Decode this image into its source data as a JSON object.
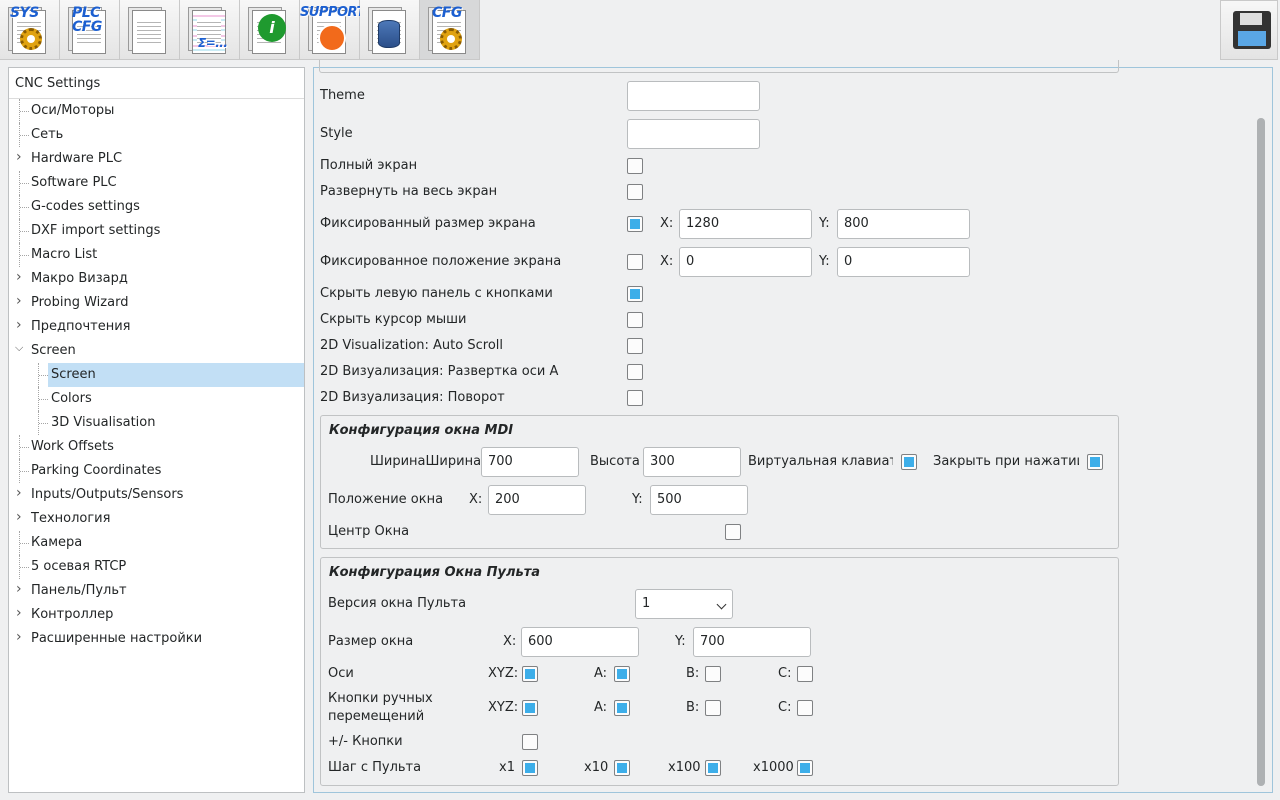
{
  "toolbar": {
    "buttons": [
      {
        "name": "sys",
        "label": "SYS"
      },
      {
        "name": "plc-cfg",
        "label": "PLC CFG"
      },
      {
        "name": "list",
        "label": ""
      },
      {
        "name": "formula",
        "label": "Σ=..."
      },
      {
        "name": "info",
        "label": "i"
      },
      {
        "name": "support",
        "label": "SUPPORT"
      },
      {
        "name": "database",
        "label": ""
      },
      {
        "name": "cfg",
        "label": "CFG"
      }
    ],
    "save_icon": "floppy-disk-icon"
  },
  "tree": {
    "header": "CNC Settings",
    "items": [
      {
        "label": "Оси/Моторы",
        "expandable": false
      },
      {
        "label": "Сеть",
        "expandable": false
      },
      {
        "label": "Hardware PLC",
        "expandable": true
      },
      {
        "label": "Software PLC",
        "expandable": false
      },
      {
        "label": "G-codes settings",
        "expandable": false
      },
      {
        "label": "DXF import settings",
        "expandable": false
      },
      {
        "label": "Macro List",
        "expandable": false
      },
      {
        "label": "Макро Визард",
        "expandable": true
      },
      {
        "label": "Probing Wizard",
        "expandable": true
      },
      {
        "label": "Предпочтения",
        "expandable": true
      },
      {
        "label": "Screen",
        "expandable": true,
        "expanded": true
      },
      {
        "label": "Screen",
        "child": true,
        "selected": true
      },
      {
        "label": "Colors",
        "child": true
      },
      {
        "label": "3D Visualisation",
        "child": true
      },
      {
        "label": "Work Offsets",
        "expandable": false
      },
      {
        "label": "Parking Coordinates",
        "expandable": false
      },
      {
        "label": "Inputs/Outputs/Sensors",
        "expandable": true
      },
      {
        "label": "Технология",
        "expandable": true
      },
      {
        "label": "Камера",
        "expandable": false
      },
      {
        "label": "5 осевая RTCP",
        "expandable": false
      },
      {
        "label": "Панель/Пульт",
        "expandable": true
      },
      {
        "label": "Контроллер",
        "expandable": true
      },
      {
        "label": "Расширенные настройки",
        "expandable": true
      }
    ]
  },
  "screen": {
    "theme_label": "Theme",
    "theme_value": "",
    "style_label": "Style",
    "style_value": "",
    "fullscreen_label": "Полный экран",
    "fullscreen": false,
    "maximize_label": "Развернуть на весь экран",
    "maximize": false,
    "fixed_size_label": "Фиксированный размер экрана",
    "fixed_size": true,
    "fixed_size_x_label": "X:",
    "fixed_size_x": "1280",
    "fixed_size_y_label": "Y:",
    "fixed_size_y": "800",
    "fixed_pos_label": "Фиксированное положение экрана",
    "fixed_pos": false,
    "fixed_pos_x_label": "X:",
    "fixed_pos_x": "0",
    "fixed_pos_y_label": "Y:",
    "fixed_pos_y": "0",
    "hide_left_panel_label": "Скрыть левую панель с кнопками",
    "hide_left_panel": true,
    "hide_cursor_label": "Скрыть курсор мыши",
    "hide_cursor": false,
    "autoscroll_label": "2D Visualization: Auto Scroll",
    "autoscroll": false,
    "sweep_a_label": "2D Визуализация: Развертка оси A",
    "sweep_a": false,
    "rotate_label": "2D Визуализация: Поворот",
    "rotate": false
  },
  "mdi": {
    "title": "Конфигурация окна MDI",
    "width_label": "ШиринаШирина",
    "width_value": "700",
    "height_label": "Высота",
    "height_value": "300",
    "keyboard_label": "Виртуальная клавиату|",
    "keyboard": true,
    "close_label": "Закрыть при нажатии I",
    "close": true,
    "pos_label": "Положение окна",
    "pos_x_label": "X:",
    "pos_x": "200",
    "pos_y_label": "Y:",
    "pos_y": "500",
    "center_label": "Центр Окна",
    "center": false
  },
  "pendant": {
    "title": "Конфигурация Окна Пульта",
    "version_label": "Версия окна Пульта",
    "version_value": "1",
    "size_label": "Размер окна",
    "size_x_label": "X:",
    "size_x": "600",
    "size_y_label": "Y:",
    "size_y": "700",
    "axes_label": "Оси",
    "jog_label_1": "Кнопки ручных",
    "jog_label_2": "перемещений",
    "xyz_label": "XYZ:",
    "a_label": "A:",
    "b_label": "B:",
    "c_label": "C:",
    "axes": {
      "xyz": true,
      "a": true,
      "b": false,
      "c": false
    },
    "jog": {
      "xyz": true,
      "a": true,
      "b": false,
      "c": false
    },
    "pm_label": "+/- Кнопки",
    "pm": false,
    "step_label": "Шаг с Пульта",
    "steps": [
      {
        "label": "x1",
        "on": true
      },
      {
        "label": "x10",
        "on": true
      },
      {
        "label": "x100",
        "on": true
      },
      {
        "label": "x1000",
        "on": true
      }
    ]
  }
}
